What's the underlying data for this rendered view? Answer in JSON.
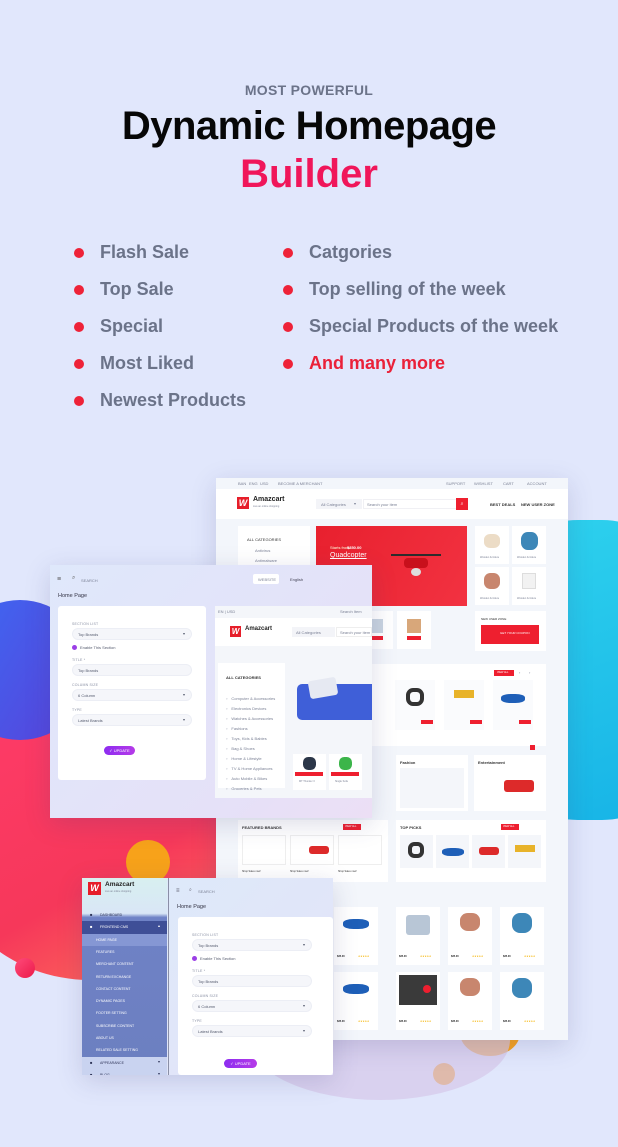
{
  "hero": {
    "eyebrow": "MOST POWERFUL",
    "title_line1": "Dynamic Homepage",
    "title_line2": "Builder"
  },
  "features": {
    "left": [
      "Flash Sale",
      "Top Sale",
      "Special",
      "Most Liked",
      "Newest Products"
    ],
    "right": [
      "Catgories",
      "Top selling of the week",
      "Special Products of the week",
      "And many more"
    ]
  },
  "colors": {
    "background": "#e1e7fc",
    "accent_pink": "#f0165a",
    "bullet_red": "#ee2238",
    "text_gray": "#6b7389",
    "update_purple": "#8d2cf0",
    "brand_red": "#e61e2a",
    "sidebar_blue": "#6c7fc0"
  },
  "storefront": {
    "brand": "Amazcart",
    "tagline": "Live an online shopping",
    "topbar_left": [
      "BAN",
      "ENG",
      "USD",
      "BECOME A MERCHANT"
    ],
    "topbar_right": [
      "SUPPORT",
      "WISHLIST",
      "CART",
      "ACCOUNT"
    ],
    "category_select": "All Categories",
    "search_placeholder": "Search your item",
    "nav_links": [
      "BEST DEALS",
      "NEW USER ZONE"
    ],
    "all_categories_label": "ALL CATEGORIES",
    "categories_short": [
      "Antivirus",
      "Antimalware"
    ],
    "banner": {
      "price_label": "Starts from",
      "price": "$350.00",
      "title": "Quadcopter"
    },
    "product_caption": "Wooden furniture",
    "new_user_zone": {
      "label": "NEW USER ZONE",
      "coupon": "GET YOUR COUPON",
      "coupon_tag": "USED 0"
    },
    "view_all": "VIEW ALL",
    "collections": [
      {
        "title": "Fashion"
      },
      {
        "title": "Entertainment"
      }
    ],
    "featured_brands": "FEATURED BRANDS",
    "top_picks": "TOP PICKS",
    "shop_sales": "Shop Sales now!",
    "price": "$35.00",
    "product_name": "JBL technology bluetooth noise cancel headset"
  },
  "admin_top": {
    "search": "SEARCH",
    "website_button": "WEBSITE",
    "language": "English",
    "page_title": "Home Page",
    "form": {
      "section_list_label": "SECTION LIST",
      "section_list_value": "Top Brands",
      "enable_label": "Enable This Section",
      "title_label": "TITLE *",
      "title_value": "Top Brands",
      "column_size_label": "COLUMN SIZE",
      "column_size_value": "6 Column",
      "type_label": "TYPE",
      "type_value": "Latest Brands",
      "update_button": "✓ UPDATE"
    }
  },
  "preview_inner": {
    "brand": "Amazcart",
    "category_select": "All Categories",
    "search_placeholder": "Search your item",
    "search_link": "Search Item",
    "all_categories_label": "ALL CATEGORIES",
    "categories": [
      "Computer & Accessories",
      "Electronics Devices",
      "Watches & Accessories",
      "Fashions",
      "Toys, Kids & Babies",
      "Bag & Shoes",
      "Home & Lifestyle",
      "TV & Home Appliances",
      "Auto Mobile & Bikes",
      "Groceries & Pets"
    ],
    "items": [
      "MT Thunder 3",
      "Single Sofa"
    ],
    "sale_tag": "$ 35.00"
  },
  "admin_bottom": {
    "brand": "Amazcart",
    "tagline": "Live an online shopping",
    "search": "SEARCH",
    "page_title": "Home Page",
    "sidebar": [
      {
        "label": "DASHBOARD",
        "type": "item"
      },
      {
        "label": "FRONTEND CMS",
        "type": "group-open"
      },
      {
        "label": "HOME PAGE",
        "type": "sub-active"
      },
      {
        "label": "FEATURES",
        "type": "sub"
      },
      {
        "label": "MERCHANT CONTENT",
        "type": "sub"
      },
      {
        "label": "RETURN EXCHANGE",
        "type": "sub"
      },
      {
        "label": "CONTACT CONTENT",
        "type": "sub"
      },
      {
        "label": "DYNAMIC PAGES",
        "type": "sub"
      },
      {
        "label": "FOOTER SETTING",
        "type": "sub"
      },
      {
        "label": "SUBSCRIBE CONTENT",
        "type": "sub"
      },
      {
        "label": "ABOUT US",
        "type": "sub"
      },
      {
        "label": "RELATED SALE SETTING",
        "type": "sub"
      },
      {
        "label": "APPEARANCE",
        "type": "group"
      },
      {
        "label": "BLOG",
        "type": "group"
      }
    ],
    "form": {
      "section_list_label": "SECTION LIST",
      "section_list_value": "Top Brands",
      "enable_label": "Enable This Section",
      "title_label": "TITLE *",
      "title_value": "Top Brands",
      "column_size_label": "COLUMN SIZE",
      "column_size_value": "6 Column",
      "type_label": "TYPE",
      "type_value": "Latest Brands",
      "update_button": "✓ UPDATE"
    }
  }
}
